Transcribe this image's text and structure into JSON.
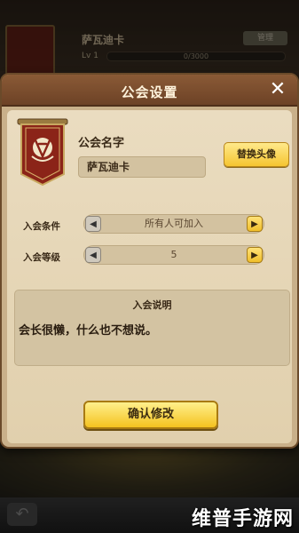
{
  "background": {
    "guild_name": "萨瓦迪卡",
    "edit_button": "管理",
    "level": "Lv 1",
    "exp": "0/3000"
  },
  "dialog": {
    "title": "公会设置",
    "close_icon": "close-icon",
    "emblem_icon": "horde-banner-icon",
    "name_label": "公会名字",
    "name_value": "萨瓦迪卡",
    "replace_avatar_button": "替换头像",
    "join_condition": {
      "label": "入会条件",
      "value": "所有人可加入"
    },
    "join_level": {
      "label": "入会等级",
      "value": "5"
    },
    "description": {
      "title": "入会说明",
      "text": "会长很懒，什么也不想说。"
    },
    "confirm_button": "确认修改"
  },
  "watermark": "维普手游网",
  "colors": {
    "header": "#7a4c2c",
    "panel": "#e6d7b8",
    "button_yellow": "#f6c62a",
    "banner_red": "#8b2418"
  }
}
